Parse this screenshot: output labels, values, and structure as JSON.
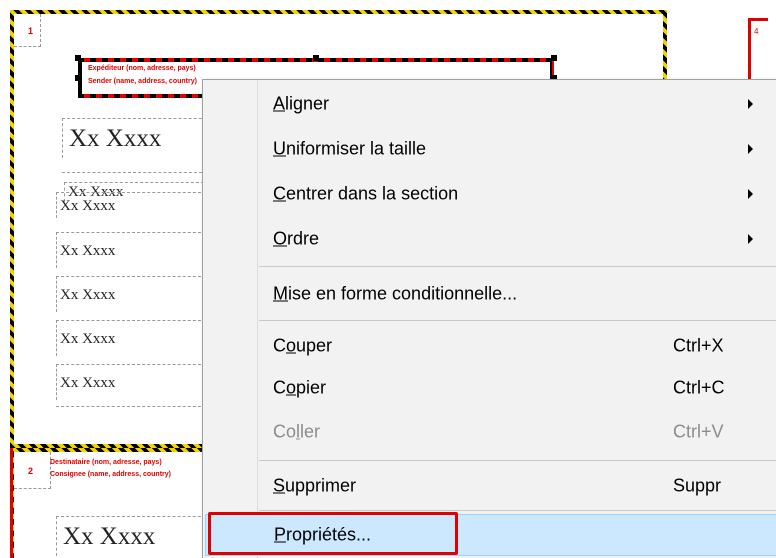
{
  "designer": {
    "section1_number": "1",
    "section2_number": "2",
    "section_right_number": "4",
    "selected_field_line1": "Expéditeur (nom, adresse, pays)",
    "selected_field_line2": "Sender (name, address, country)",
    "fields": [
      {
        "text": "Xx Xxxx",
        "size": "big"
      },
      {
        "text": "Xx Xxxx",
        "size": "small"
      },
      {
        "text": "Xx Xxxx",
        "size": "small"
      },
      {
        "text": "Xx Xxxx",
        "size": "small"
      },
      {
        "text": "Xx Xxxx",
        "size": "small"
      },
      {
        "text": "Xx Xxxx",
        "size": "small"
      },
      {
        "text": "Xx Xxxx",
        "size": "small"
      }
    ],
    "section2_line1": "Destinataire (nom, adresse, pays)",
    "section2_line2": "Consignee (name, address, country)",
    "section2_field": "Xx Xxxx"
  },
  "menu": {
    "items": [
      {
        "pre": "",
        "acc": "A",
        "post": "ligner",
        "shortcut": "",
        "submenu": true,
        "disabled": false
      },
      {
        "pre": "",
        "acc": "U",
        "post": "niformiser la taille",
        "shortcut": "",
        "submenu": true,
        "disabled": false
      },
      {
        "pre": "",
        "acc": "C",
        "post": "entrer dans la section",
        "shortcut": "",
        "submenu": true,
        "disabled": false
      },
      {
        "pre": "",
        "acc": "O",
        "post": "rdre",
        "shortcut": "",
        "submenu": true,
        "disabled": false
      },
      {
        "pre": "",
        "acc": "M",
        "post": "ise en forme conditionnelle...",
        "shortcut": "",
        "submenu": false,
        "disabled": false
      },
      {
        "pre": "C",
        "acc": "o",
        "post": "uper",
        "shortcut": "Ctrl+X",
        "submenu": false,
        "disabled": false
      },
      {
        "pre": "C",
        "acc": "o",
        "post": "pier",
        "shortcut": "Ctrl+C",
        "submenu": false,
        "disabled": false
      },
      {
        "pre": "Co",
        "acc": "l",
        "post": "ler",
        "shortcut": "Ctrl+V",
        "submenu": false,
        "disabled": true
      },
      {
        "pre": "",
        "acc": "S",
        "post": "upprimer",
        "shortcut": "Suppr",
        "submenu": false,
        "disabled": false
      },
      {
        "pre": "",
        "acc": "P",
        "post": "ropriétés...",
        "shortcut": "",
        "submenu": false,
        "disabled": false,
        "highlighted": true
      }
    ]
  },
  "colors": {
    "highlight_bg": "#cce8ff",
    "highlight_border": "#99d1ff",
    "callout": "#e00000",
    "menu_bg": "#f2f2f2"
  }
}
